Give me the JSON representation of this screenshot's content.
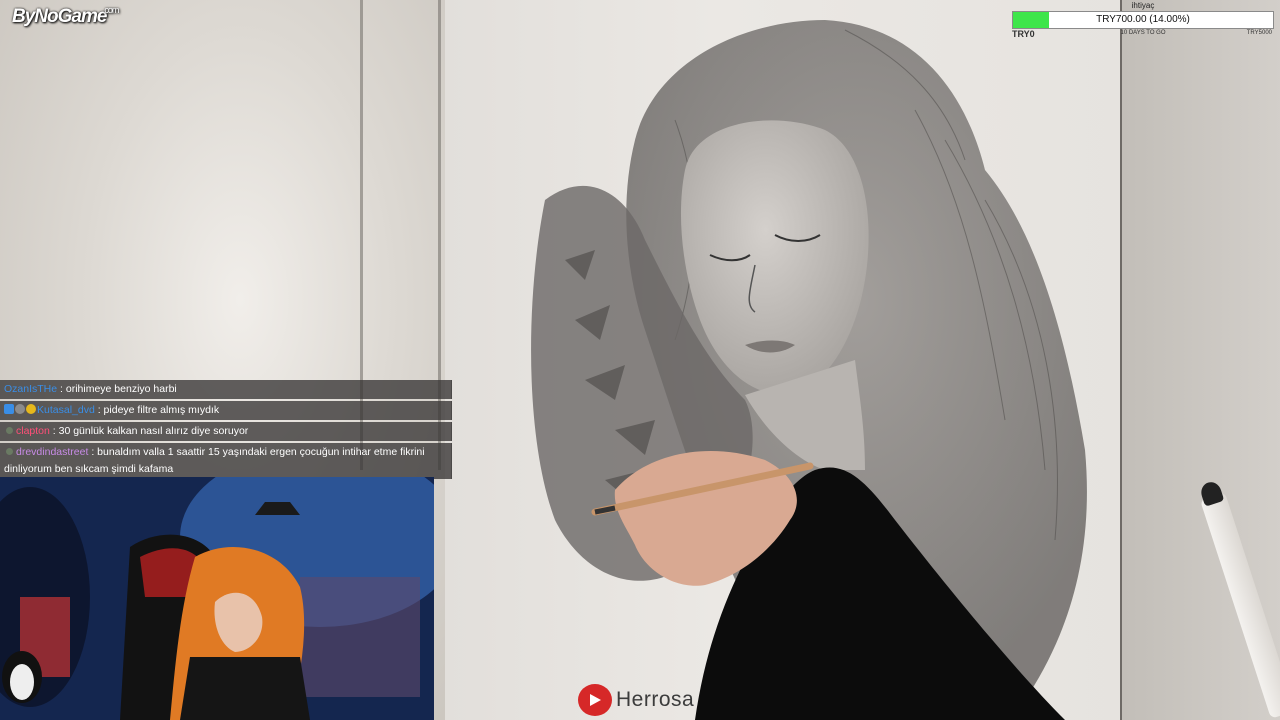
{
  "logo": {
    "text": "ByNoGame",
    "suffix": "com"
  },
  "goal": {
    "title": "ihtiyaç",
    "amount_text": "TRY700.00 (14.00%)",
    "progress_percent": 14,
    "min_label": "TRY0",
    "days_left": "10 DAYS TO GO",
    "max_label": "TRY5000",
    "fill_color": "#3ee54a"
  },
  "chat": {
    "messages": [
      {
        "username": "OzanIsTHe",
        "name_color": "#3a8ee6",
        "badges": [],
        "text": ": orihimeye benziyo harbi"
      },
      {
        "username": "Kutasal_dvd",
        "name_color": "#3a8ee6",
        "badges": [
          "b1",
          "b2",
          "b3"
        ],
        "text": ": pideye filtre almış mıydık"
      },
      {
        "username": "clapton",
        "name_color": "#ff4f78",
        "badges": [
          "dot"
        ],
        "text": ": 30 günlük kalkan nasıl alırız diye soruyor"
      },
      {
        "username": "drevdindastreet",
        "name_color": "#c78be6",
        "badges": [
          "dot"
        ],
        "text": ": bunaldım valla 1 saattir 15 yaşındaki ergen çocuğun intihar etme fikrini dinliyorum ben sıkcam şimdi kafama"
      }
    ]
  },
  "watermark": {
    "text": "Herrosa",
    "icon": "youtube-play-icon"
  }
}
